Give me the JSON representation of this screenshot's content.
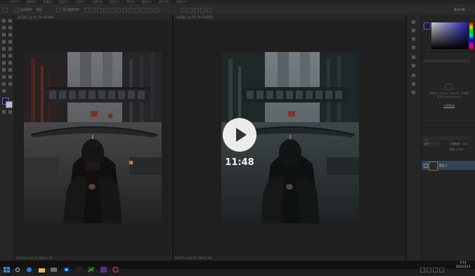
{
  "menubar": {
    "items": [
      "文件(F)",
      "编辑(E)",
      "图像(I)",
      "图层(L)",
      "文字(Y)",
      "选择(S)",
      "滤镜(T)",
      "3D(D)",
      "视图(V)",
      "窗口(W)",
      "帮助(H)"
    ]
  },
  "options_bar": {
    "item1": "自动选择",
    "item2": "图层",
    "item3": "显示变换控件",
    "workspace": "基本功能"
  },
  "documents": {
    "left_tab": "未标题-1 @ 66.7% (RGB/8)",
    "right_tab": "未标题-2 @ 66.7% (RGB/8)",
    "left_status": "66.67%   文档:33.7M/33.7M",
    "right_status": "66.67%   文档:33.7M/33.7M"
  },
  "panels": {
    "color_tab": "颜色",
    "swatch_tab": "色板",
    "library_tab": "库",
    "adjust_tab": "调整",
    "library_msg": "要使用 Creative Cloud 库，您需要登录 Creative Cloud",
    "login_link": "立即登录",
    "layers_tab": "图层",
    "channels_tab": "通道",
    "paths_tab": "路径",
    "blend_mode": "正常",
    "opacity": "不透明度: 100%",
    "fill": "填充: 100%",
    "layer_name": "图层 1"
  },
  "video": {
    "duration": "11:48"
  },
  "taskbar": {
    "time": "0:14",
    "date": "2023/3/13"
  },
  "colors": {
    "accent": "#0b73c7",
    "panel": "#2c2c2c",
    "canvas_bg": "#262626"
  }
}
